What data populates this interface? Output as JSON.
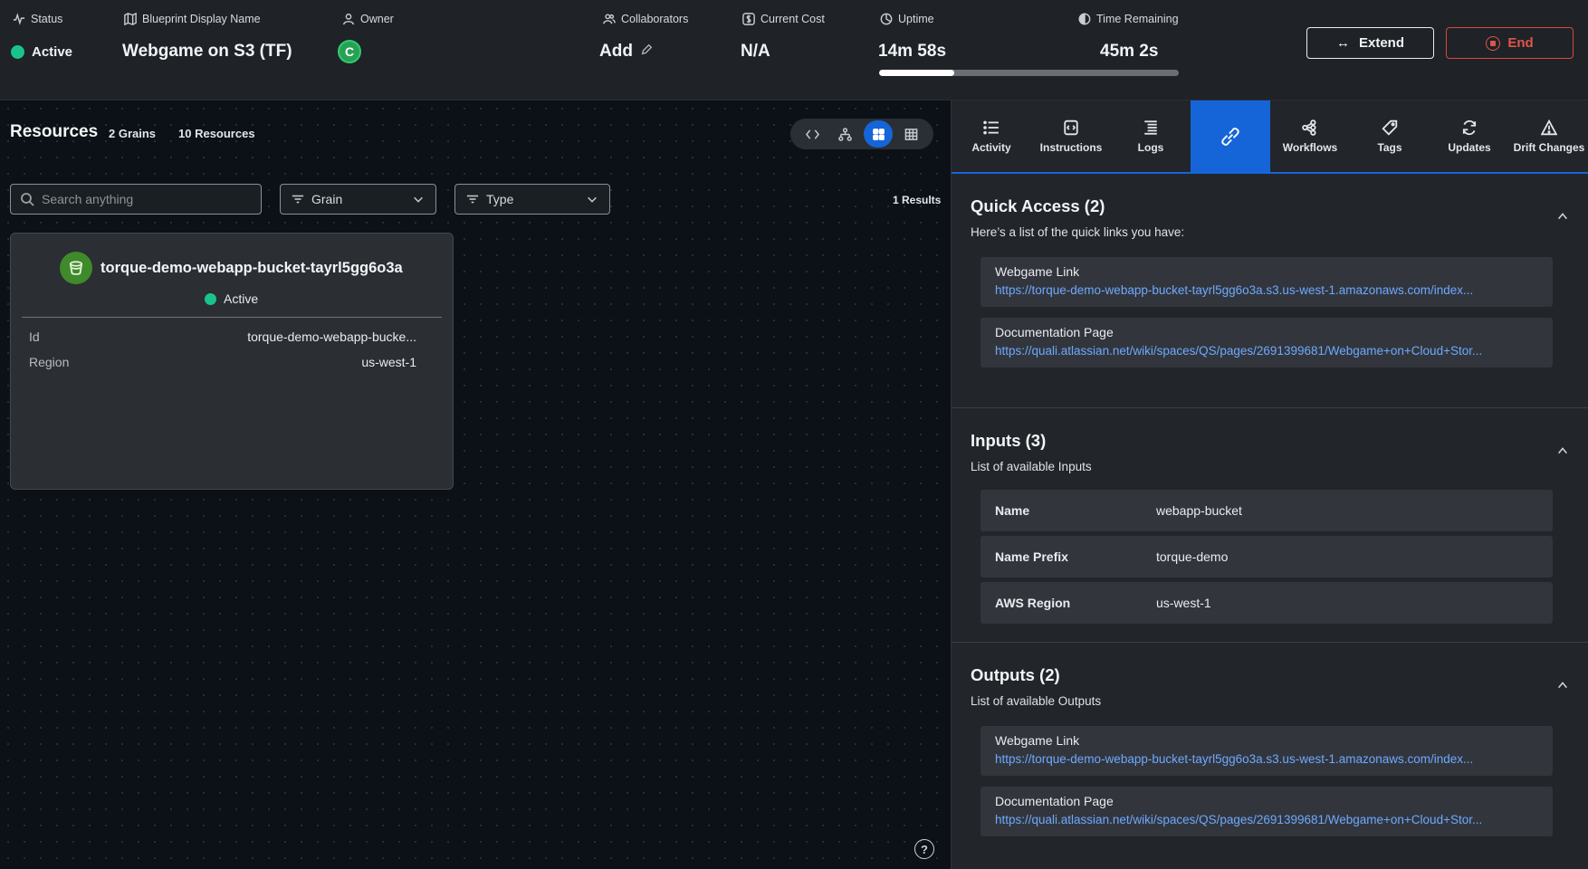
{
  "header": {
    "status_label": "Status",
    "status_value": "Active",
    "blueprint_label": "Blueprint Display Name",
    "blueprint_value": "Webgame on S3 (TF)",
    "owner_label": "Owner",
    "owner_initial": "C",
    "collaborators_label": "Collaborators",
    "collaborators_value": "Add",
    "cost_label": "Current Cost",
    "cost_value": "N/A",
    "uptime_label": "Uptime",
    "uptime_value": "14m 58s",
    "time_remaining_label": "Time Remaining",
    "time_remaining_value": "45m 2s",
    "uptime_progress_fraction": 0.25,
    "extend_label": "Extend",
    "end_label": "End"
  },
  "resources": {
    "title": "Resources",
    "grains": "2 Grains",
    "count": "10 Resources",
    "search_placeholder": "Search anything",
    "filter_grain": "Grain",
    "filter_type": "Type",
    "results": "1 Results",
    "card": {
      "name": "torque-demo-webapp-bucket-tayrl5gg6o3a",
      "status": "Active",
      "id_label": "Id",
      "id_value": "torque-demo-webapp-bucke...",
      "region_label": "Region",
      "region_value": "us-west-1"
    }
  },
  "tabs": [
    {
      "label": "Activity",
      "icon": "list-icon"
    },
    {
      "label": "Instructions",
      "icon": "code-doc-icon"
    },
    {
      "label": "Logs",
      "icon": "logs-icon"
    },
    {
      "label": "",
      "icon": "link-icon",
      "active": true
    },
    {
      "label": "Workflows",
      "icon": "workflow-icon"
    },
    {
      "label": "Tags",
      "icon": "tag-icon"
    },
    {
      "label": "Updates",
      "icon": "refresh-icon"
    },
    {
      "label": "Drift Changes",
      "icon": "warning-icon"
    }
  ],
  "quick_access": {
    "title": "Quick Access (2)",
    "subtitle": "Here’s a list of the quick links you have:",
    "links": [
      {
        "name": "Webgame Link",
        "url": "https://torque-demo-webapp-bucket-tayrl5gg6o3a.s3.us-west-1.amazonaws.com/index..."
      },
      {
        "name": "Documentation Page",
        "url": "https://quali.atlassian.net/wiki/spaces/QS/pages/2691399681/Webgame+on+Cloud+Stor..."
      }
    ]
  },
  "inputs": {
    "title": "Inputs (3)",
    "subtitle": "List of available Inputs",
    "rows": [
      {
        "name": "Name",
        "value": "webapp-bucket"
      },
      {
        "name": "Name Prefix",
        "value": "torque-demo"
      },
      {
        "name": "AWS Region",
        "value": "us-west-1"
      }
    ]
  },
  "outputs": {
    "title": "Outputs (2)",
    "subtitle": "List of available Outputs",
    "links": [
      {
        "name": "Webgame Link",
        "url": "https://torque-demo-webapp-bucket-tayrl5gg6o3a.s3.us-west-1.amazonaws.com/index..."
      },
      {
        "name": "Documentation Page",
        "url": "https://quali.atlassian.net/wiki/spaces/QS/pages/2691399681/Webgame+on+Cloud+Stor..."
      }
    ]
  },
  "help_label": "?",
  "colors": {
    "accent": "#1665d8",
    "active_green": "#19c48c",
    "danger": "#e0554b",
    "link": "#6ea8ff"
  }
}
